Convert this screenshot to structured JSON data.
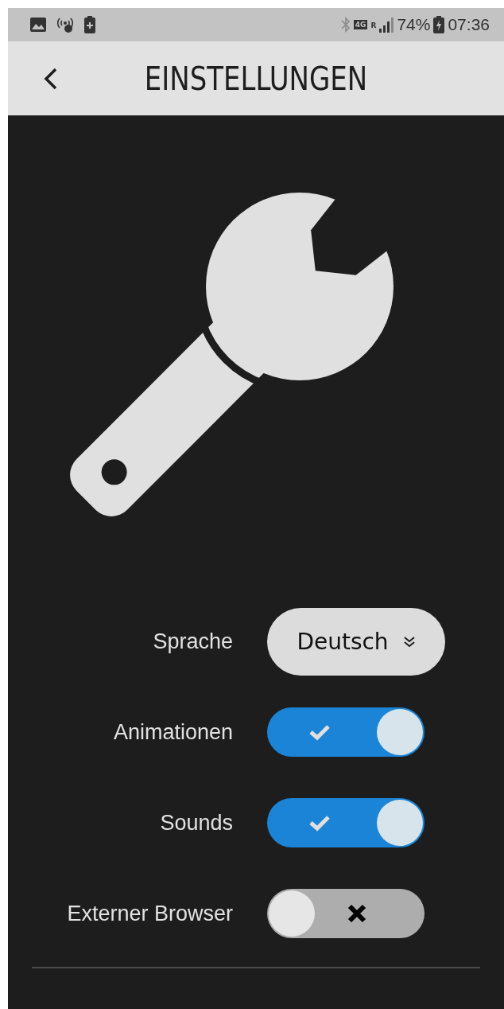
{
  "status_bar": {
    "network": "4G",
    "roaming": "R",
    "battery": "74%",
    "time": "07:36"
  },
  "header": {
    "title": "EINSTELLUNGEN"
  },
  "settings": [
    {
      "kind": "dropdown",
      "label": "Sprache",
      "value": "Deutsch"
    },
    {
      "kind": "toggle",
      "label": "Animationen",
      "on": true
    },
    {
      "kind": "toggle",
      "label": "Sounds",
      "on": true
    },
    {
      "kind": "toggle",
      "label": "Externer Browser",
      "on": false
    }
  ]
}
